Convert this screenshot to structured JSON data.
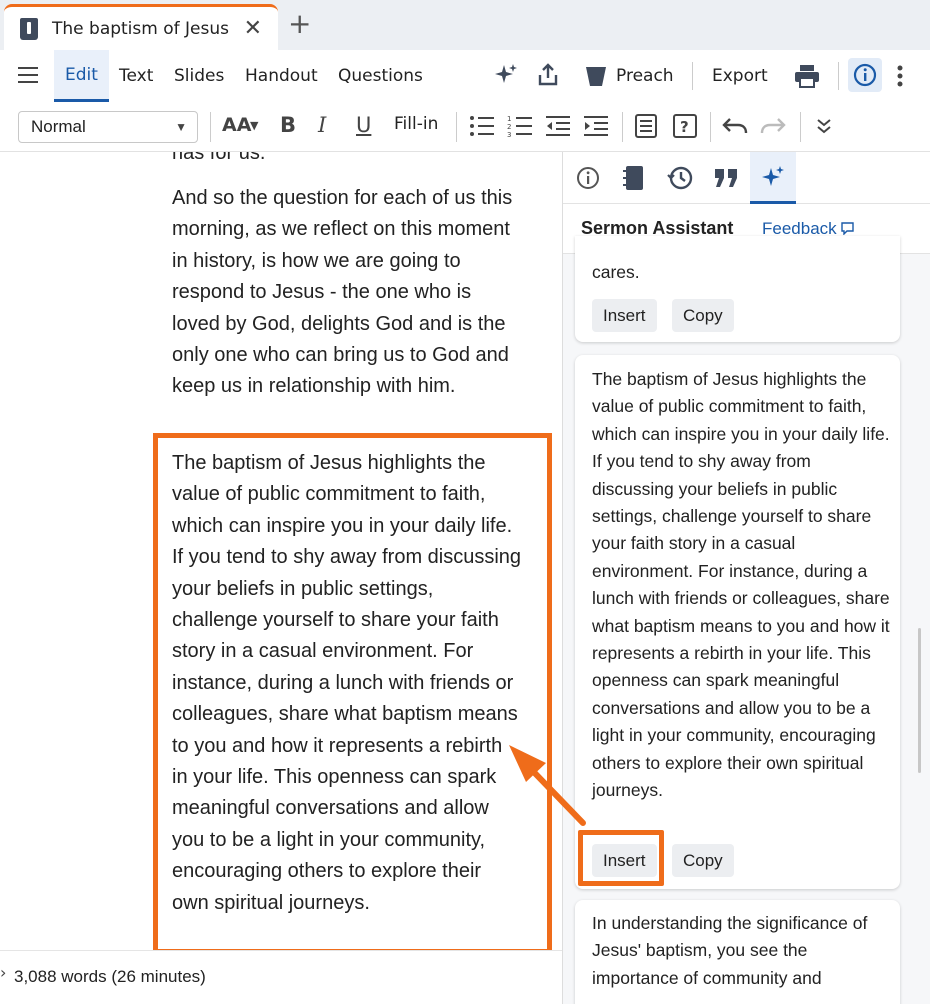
{
  "browser": {
    "tab_title": "The baptism of Jesus",
    "close_glyph": "✕",
    "new_tab_glyph": "+"
  },
  "menu": {
    "edit": "Edit",
    "text": "Text",
    "slides": "Slides",
    "handout": "Handout",
    "questions": "Questions",
    "preach": "Preach",
    "export": "Export"
  },
  "toolbar": {
    "style_value": "Normal",
    "bold": "B",
    "italic": "I",
    "underline": "U",
    "fill_in": "Fill-in",
    "font_size_icon": "AA"
  },
  "document": {
    "top_fragment": "has for us.",
    "paragraph_1": "And so the question for each of us this morning, as we reflect on this moment in history, is how we are going to respond to Jesus - the one who is loved by God, delights God and is the only one who can bring us to God and keep us in relationship with him.",
    "paragraph_2": "The baptism of Jesus highlights the value of public commitment to faith, which can inspire you in your daily life. If you tend to shy away from discussing your beliefs in public settings, challenge yourself to share your faith story in a casual environment. For instance, during a lunch with friends or colleagues, share what baptism means to you and how it represents a rebirth in your life. This openness can spark meaningful conversations and allow you to be a light in your community, encouraging others to explore their own spiritual journeys."
  },
  "status": {
    "word_count": "3,088 words (26 minutes)"
  },
  "panel": {
    "title": "Sermon Assistant",
    "feedback": "Feedback",
    "cards": [
      {
        "text": "cares.",
        "insert": "Insert",
        "copy": "Copy"
      },
      {
        "text": "The baptism of Jesus highlights the value of public commitment to faith, which can inspire you in your daily life. If you tend to shy away from discussing your beliefs in public settings, challenge yourself to share your faith story in a casual environment. For instance, during a lunch with friends or colleagues, share what baptism means to you and how it represents a rebirth in your life. This openness can spark meaningful conversations and allow you to be a light in your community, encouraging others to explore their own spiritual journeys.",
        "insert": "Insert",
        "copy": "Copy"
      },
      {
        "text": "In understanding the significance of Jesus' baptism, you see the importance of community and"
      }
    ]
  },
  "colors": {
    "accent": "#1a5aa8",
    "highlight": "#ef6c1a"
  },
  "icons": [
    "menu-icon",
    "sparkle-icon",
    "share-icon",
    "pulpit-icon",
    "print-icon",
    "info-icon",
    "more-vertical-icon",
    "bulleted-list-icon",
    "numbered-list-icon",
    "outdent-icon",
    "indent-icon",
    "slide-icon",
    "question-box-icon",
    "undo-icon",
    "redo-icon",
    "expand-more-icon",
    "notebook-icon",
    "history-icon",
    "quote-icon",
    "feedback-icon",
    "document-icon"
  ]
}
